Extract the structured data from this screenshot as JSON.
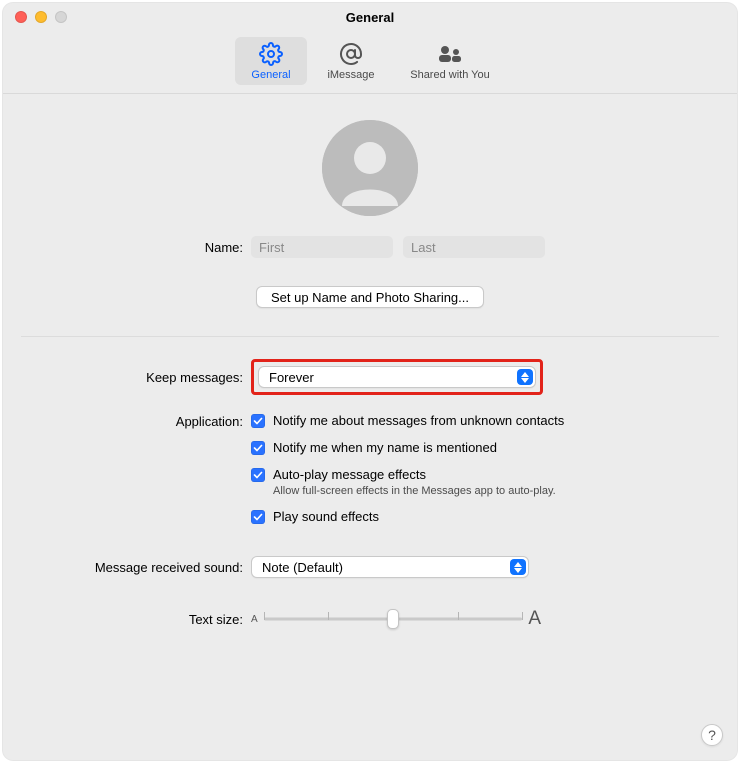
{
  "window": {
    "title": "General"
  },
  "tabs": {
    "general": "General",
    "imessage": "iMessage",
    "shared": "Shared with You"
  },
  "profile": {
    "name_label": "Name:",
    "first_placeholder": "First",
    "last_placeholder": "Last",
    "setup_button": "Set up Name and Photo Sharing..."
  },
  "keep": {
    "label": "Keep messages:",
    "value": "Forever"
  },
  "application": {
    "label": "Application:",
    "checks": [
      {
        "label": "Notify me about messages from unknown contacts",
        "checked": true
      },
      {
        "label": "Notify me when my name is mentioned",
        "checked": true
      },
      {
        "label": "Auto-play message effects",
        "checked": true,
        "sub": "Allow full-screen effects in the Messages app to auto-play."
      },
      {
        "label": "Play sound effects",
        "checked": true
      }
    ]
  },
  "sound": {
    "label": "Message received sound:",
    "value": "Note (Default)"
  },
  "textsize": {
    "label": "Text size:",
    "small": "A",
    "big": "A",
    "position": 0.5
  },
  "help": "?"
}
